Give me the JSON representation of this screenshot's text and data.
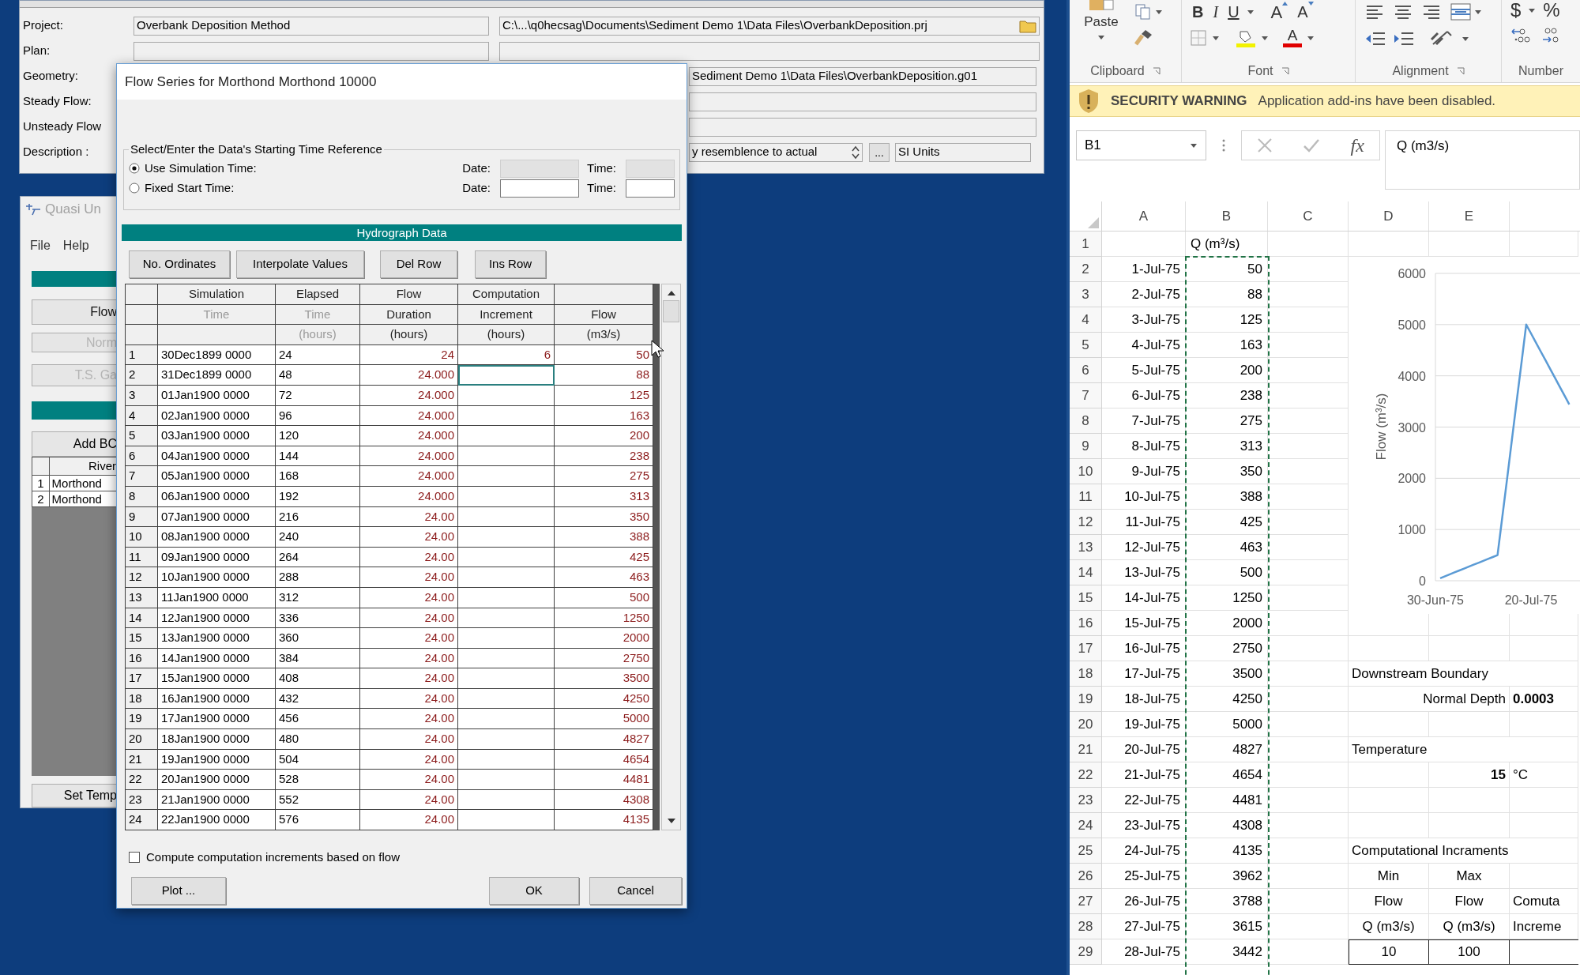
{
  "main_window": {
    "rows": [
      {
        "label": "Project:",
        "kind": "project",
        "value": "Overbank Deposition Method",
        "path": "C:\\...\\q0hecsag\\Documents\\Sediment Demo 1\\Data Files\\OverbankDeposition.prj"
      },
      {
        "label": "Plan:",
        "kind": "plain"
      },
      {
        "label": "Geometry:",
        "kind": "covered",
        "path": "Sediment Demo 1\\Data Files\\OverbankDeposition.g01"
      },
      {
        "label": "Steady Flow:",
        "kind": "covered"
      },
      {
        "label": "Unsteady Flow",
        "kind": "covered"
      },
      {
        "label": "Description :",
        "kind": "description",
        "value": "y resemblence to actual",
        "browse": "...",
        "units": "SI Units"
      }
    ]
  },
  "quasi_window": {
    "title": "Quasi Un",
    "menu": [
      "File",
      "Help"
    ],
    "buttons": [
      {
        "label": "Flow",
        "disabled": false
      },
      {
        "label": "Norm",
        "disabled": true
      },
      {
        "label": "T.S. Ga",
        "disabled": true
      }
    ],
    "add_button": "Add BC",
    "table": {
      "header": "River",
      "rows": [
        {
          "index": "1",
          "river": "Morthond"
        },
        {
          "index": "2",
          "river": "Morthond"
        }
      ]
    },
    "bottom_button": "Set Temp"
  },
  "dialog": {
    "title": "Flow Series for Morthond Morthond 10000",
    "group": {
      "title": "Select/Enter the Data's Starting Time Reference",
      "options": [
        {
          "label": "Use Simulation Time:",
          "selected": true,
          "date_label": "Date:",
          "time_label": "Time:",
          "fields_disabled": true
        },
        {
          "label": "Fixed Start Time:",
          "selected": false,
          "date_label": "Date:",
          "time_label": "Time:",
          "fields_disabled": false
        }
      ]
    },
    "section_title": "Hydrograph Data",
    "buttons": [
      "No. Ordinates",
      "Interpolate Values",
      "Del Row",
      "Ins Row"
    ],
    "table": {
      "columns": [
        {
          "line_1": {
            "text": "Simulation",
            "disabled": false
          },
          "line_2": {
            "text": "Time",
            "disabled": true
          }
        },
        {
          "line_1": {
            "text": "Elapsed",
            "disabled": false
          },
          "line_2": {
            "text": "Time",
            "disabled": true
          },
          "line_3": {
            "text": "(hours)",
            "disabled": true
          }
        },
        {
          "line_1": {
            "text": "Flow",
            "disabled": false
          },
          "line_2": {
            "text": "Duration",
            "disabled": false
          },
          "line_3": {
            "text": "(hours)",
            "disabled": false
          }
        },
        {
          "line_1": {
            "text": "Computation",
            "disabled": false
          },
          "line_2": {
            "text": "Increment",
            "disabled": false
          },
          "line_3": {
            "text": "(hours)",
            "disabled": false
          }
        },
        {
          "line_2": {
            "text": "Flow",
            "disabled": false
          },
          "line_3": {
            "text": "(m3/s)",
            "disabled": false
          }
        }
      ],
      "rows": [
        {
          "index": "1",
          "time": "30Dec1899 0000",
          "elapsed": "24",
          "duration": "24",
          "increment": "6",
          "flow": "50",
          "increment_focused": false
        },
        {
          "index": "2",
          "time": "31Dec1899 0000",
          "elapsed": "48",
          "duration": "24.000",
          "flow": "88",
          "increment_focused": true
        },
        {
          "index": "3",
          "time": "01Jan1900 0000",
          "elapsed": "72",
          "duration": "24.000",
          "flow": "125",
          "increment_focused": false
        },
        {
          "index": "4",
          "time": "02Jan1900 0000",
          "elapsed": "96",
          "duration": "24.000",
          "flow": "163",
          "increment_focused": false
        },
        {
          "index": "5",
          "time": "03Jan1900 0000",
          "elapsed": "120",
          "duration": "24.000",
          "flow": "200",
          "increment_focused": false
        },
        {
          "index": "6",
          "time": "04Jan1900 0000",
          "elapsed": "144",
          "duration": "24.000",
          "flow": "238",
          "increment_focused": false
        },
        {
          "index": "7",
          "time": "05Jan1900 0000",
          "elapsed": "168",
          "duration": "24.000",
          "flow": "275",
          "increment_focused": false
        },
        {
          "index": "8",
          "time": "06Jan1900 0000",
          "elapsed": "192",
          "duration": "24.000",
          "flow": "313",
          "increment_focused": false
        },
        {
          "index": "9",
          "time": "07Jan1900 0000",
          "elapsed": "216",
          "duration": "24.00",
          "flow": "350",
          "increment_focused": false
        },
        {
          "index": "10",
          "time": "08Jan1900 0000",
          "elapsed": "240",
          "duration": "24.00",
          "flow": "388",
          "increment_focused": false
        },
        {
          "index": "11",
          "time": "09Jan1900 0000",
          "elapsed": "264",
          "duration": "24.00",
          "flow": "425",
          "increment_focused": false
        },
        {
          "index": "12",
          "time": "10Jan1900 0000",
          "elapsed": "288",
          "duration": "24.00",
          "flow": "463",
          "increment_focused": false
        },
        {
          "index": "13",
          "time": "11Jan1900 0000",
          "elapsed": "312",
          "duration": "24.00",
          "flow": "500",
          "increment_focused": false
        },
        {
          "index": "14",
          "time": "12Jan1900 0000",
          "elapsed": "336",
          "duration": "24.00",
          "flow": "1250",
          "increment_focused": false
        },
        {
          "index": "15",
          "time": "13Jan1900 0000",
          "elapsed": "360",
          "duration": "24.00",
          "flow": "2000",
          "increment_focused": false
        },
        {
          "index": "16",
          "time": "14Jan1900 0000",
          "elapsed": "384",
          "duration": "24.00",
          "flow": "2750",
          "increment_focused": false
        },
        {
          "index": "17",
          "time": "15Jan1900 0000",
          "elapsed": "408",
          "duration": "24.00",
          "flow": "3500",
          "increment_focused": false
        },
        {
          "index": "18",
          "time": "16Jan1900 0000",
          "elapsed": "432",
          "duration": "24.00",
          "flow": "4250",
          "increment_focused": false
        },
        {
          "index": "19",
          "time": "17Jan1900 0000",
          "elapsed": "456",
          "duration": "24.00",
          "flow": "5000",
          "increment_focused": false
        },
        {
          "index": "20",
          "time": "18Jan1900 0000",
          "elapsed": "480",
          "duration": "24.00",
          "flow": "4827",
          "increment_focused": false
        },
        {
          "index": "21",
          "time": "19Jan1900 0000",
          "elapsed": "504",
          "duration": "24.00",
          "flow": "4654",
          "increment_focused": false
        },
        {
          "index": "22",
          "time": "20Jan1900 0000",
          "elapsed": "528",
          "duration": "24.00",
          "flow": "4481",
          "increment_focused": false
        },
        {
          "index": "23",
          "time": "21Jan1900 0000",
          "elapsed": "552",
          "duration": "24.00",
          "flow": "4308",
          "increment_focused": false
        },
        {
          "index": "24",
          "time": "22Jan1900 0000",
          "elapsed": "576",
          "duration": "24.00",
          "flow": "4135",
          "increment_focused": false
        }
      ]
    },
    "checkbox": {
      "label": "Compute computation increments based on flow",
      "checked": false
    },
    "footer_buttons": [
      "Plot ...",
      "OK",
      "Cancel"
    ]
  },
  "excel": {
    "ribbon": {
      "groups": [
        "Clipboard",
        "Font",
        "Alignment",
        "Number"
      ],
      "paste": "Paste",
      "bold": "B",
      "italic": "I",
      "underline": "U",
      "grow_font": "A",
      "shrink_font": "A",
      "font_color": "A",
      "currency": "$",
      "percent": "%"
    },
    "security": {
      "title": "SECURITY WARNING",
      "message": "Application add-ins have been disabled."
    },
    "name_box": "B1",
    "function_symbol": "fx",
    "formula": "Q (m3/s)",
    "columns": [
      "A",
      "B",
      "C",
      "D",
      "E"
    ],
    "rows": [
      {
        "number": "1",
        "kind": "header",
        "b": "Q (m³/s)"
      },
      {
        "number": "2",
        "kind": "data",
        "a": "1-Jul-75",
        "b": "50"
      },
      {
        "number": "3",
        "kind": "data",
        "a": "2-Jul-75",
        "b": "88"
      },
      {
        "number": "4",
        "kind": "data",
        "a": "3-Jul-75",
        "b": "125"
      },
      {
        "number": "5",
        "kind": "data",
        "a": "4-Jul-75",
        "b": "163"
      },
      {
        "number": "6",
        "kind": "data",
        "a": "5-Jul-75",
        "b": "200"
      },
      {
        "number": "7",
        "kind": "data",
        "a": "6-Jul-75",
        "b": "238"
      },
      {
        "number": "8",
        "kind": "data",
        "a": "7-Jul-75",
        "b": "275"
      },
      {
        "number": "9",
        "kind": "data",
        "a": "8-Jul-75",
        "b": "313"
      },
      {
        "number": "10",
        "kind": "data",
        "a": "9-Jul-75",
        "b": "350"
      },
      {
        "number": "11",
        "kind": "data",
        "a": "10-Jul-75",
        "b": "388"
      },
      {
        "number": "12",
        "kind": "data",
        "a": "11-Jul-75",
        "b": "425"
      },
      {
        "number": "13",
        "kind": "data",
        "a": "12-Jul-75",
        "b": "463"
      },
      {
        "number": "14",
        "kind": "data",
        "a": "13-Jul-75",
        "b": "500"
      },
      {
        "number": "15",
        "kind": "data",
        "a": "14-Jul-75",
        "b": "1250"
      },
      {
        "number": "16",
        "kind": "data",
        "a": "15-Jul-75",
        "b": "2000"
      },
      {
        "number": "17",
        "kind": "data",
        "a": "16-Jul-75",
        "b": "2750"
      },
      {
        "number": "18",
        "kind": "data",
        "a": "17-Jul-75",
        "b": "3500",
        "side": {
          "kind": "title",
          "d": "Downstream Boundary"
        }
      },
      {
        "number": "19",
        "kind": "data",
        "a": "18-Jul-75",
        "b": "4250",
        "side": {
          "kind": "param",
          "d": "Normal Depth",
          "f": "0.0003"
        }
      },
      {
        "number": "20",
        "kind": "data",
        "a": "19-Jul-75",
        "b": "5000"
      },
      {
        "number": "21",
        "kind": "data",
        "a": "20-Jul-75",
        "b": "4827",
        "side": {
          "kind": "title",
          "d": "Temperature"
        }
      },
      {
        "number": "22",
        "kind": "data",
        "a": "21-Jul-75",
        "b": "4654",
        "side": {
          "kind": "value",
          "e": "15",
          "f": "°C"
        }
      },
      {
        "number": "23",
        "kind": "data",
        "a": "22-Jul-75",
        "b": "4481"
      },
      {
        "number": "24",
        "kind": "data",
        "a": "23-Jul-75",
        "b": "4308"
      },
      {
        "number": "25",
        "kind": "data",
        "a": "24-Jul-75",
        "b": "4135",
        "side": {
          "kind": "title",
          "d": "Computational Incraments"
        }
      },
      {
        "number": "26",
        "kind": "data",
        "a": "25-Jul-75",
        "b": "3962",
        "side": {
          "kind": "head",
          "d": "Min",
          "e": "Max"
        }
      },
      {
        "number": "27",
        "kind": "data",
        "a": "26-Jul-75",
        "b": "3788",
        "side": {
          "kind": "head",
          "d": "Flow",
          "e": "Flow",
          "f": "Comuta"
        }
      },
      {
        "number": "28",
        "kind": "data",
        "a": "27-Jul-75",
        "b": "3615",
        "side": {
          "kind": "head",
          "d": "Q (m3/s)",
          "e": "Q (m3/s)",
          "f": "Increme"
        }
      },
      {
        "number": "29",
        "kind": "data",
        "a": "28-Jul-75",
        "b": "3442",
        "side": {
          "kind": "table_row",
          "d": "10",
          "e": "100"
        }
      }
    ],
    "chart_data": {
      "type": "line",
      "ylabel": "Flow (m³/s)",
      "categories": [
        "30-Jun-75",
        null,
        null,
        null,
        null,
        null,
        null,
        null,
        null,
        null,
        null,
        null,
        null,
        null,
        null,
        null,
        null,
        null,
        null,
        null,
        "20-Jul-75",
        null,
        null,
        null,
        null,
        null,
        null,
        null,
        null
      ],
      "series": [
        {
          "color": "#5b9bd5",
          "values": [
            null,
            50,
            88,
            125,
            163,
            200,
            238,
            275,
            313,
            350,
            388,
            425,
            463,
            500,
            1250,
            2000,
            2750,
            3500,
            4250,
            5000,
            4827,
            4654,
            4481,
            4308,
            4135,
            3962,
            3788,
            3615,
            3442
          ]
        }
      ],
      "ylim": [
        0,
        6000
      ],
      "grid": true,
      "yticks": [
        0,
        1000,
        2000,
        3000,
        4000,
        5000,
        6000
      ]
    }
  }
}
